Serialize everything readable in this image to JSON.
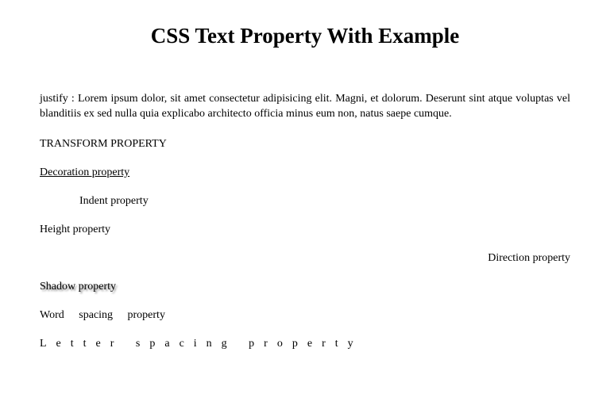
{
  "title": "CSS Text Property With Example",
  "examples": {
    "justify": "justify : Lorem ipsum dolor, sit amet consectetur adipisicing elit. Magni, et dolorum. Deserunt sint atque voluptas vel blanditiis ex sed nulla quia explicabo architecto officia minus eum non, natus saepe cumque.",
    "transform": "Transform property",
    "decoration": "Decoration property",
    "indent": "Indent property",
    "height": "Height property",
    "direction": "Direction property",
    "shadow": "Shadow property",
    "word_spacing": "Word spacing property",
    "letter_spacing": "Letter spacing property"
  }
}
